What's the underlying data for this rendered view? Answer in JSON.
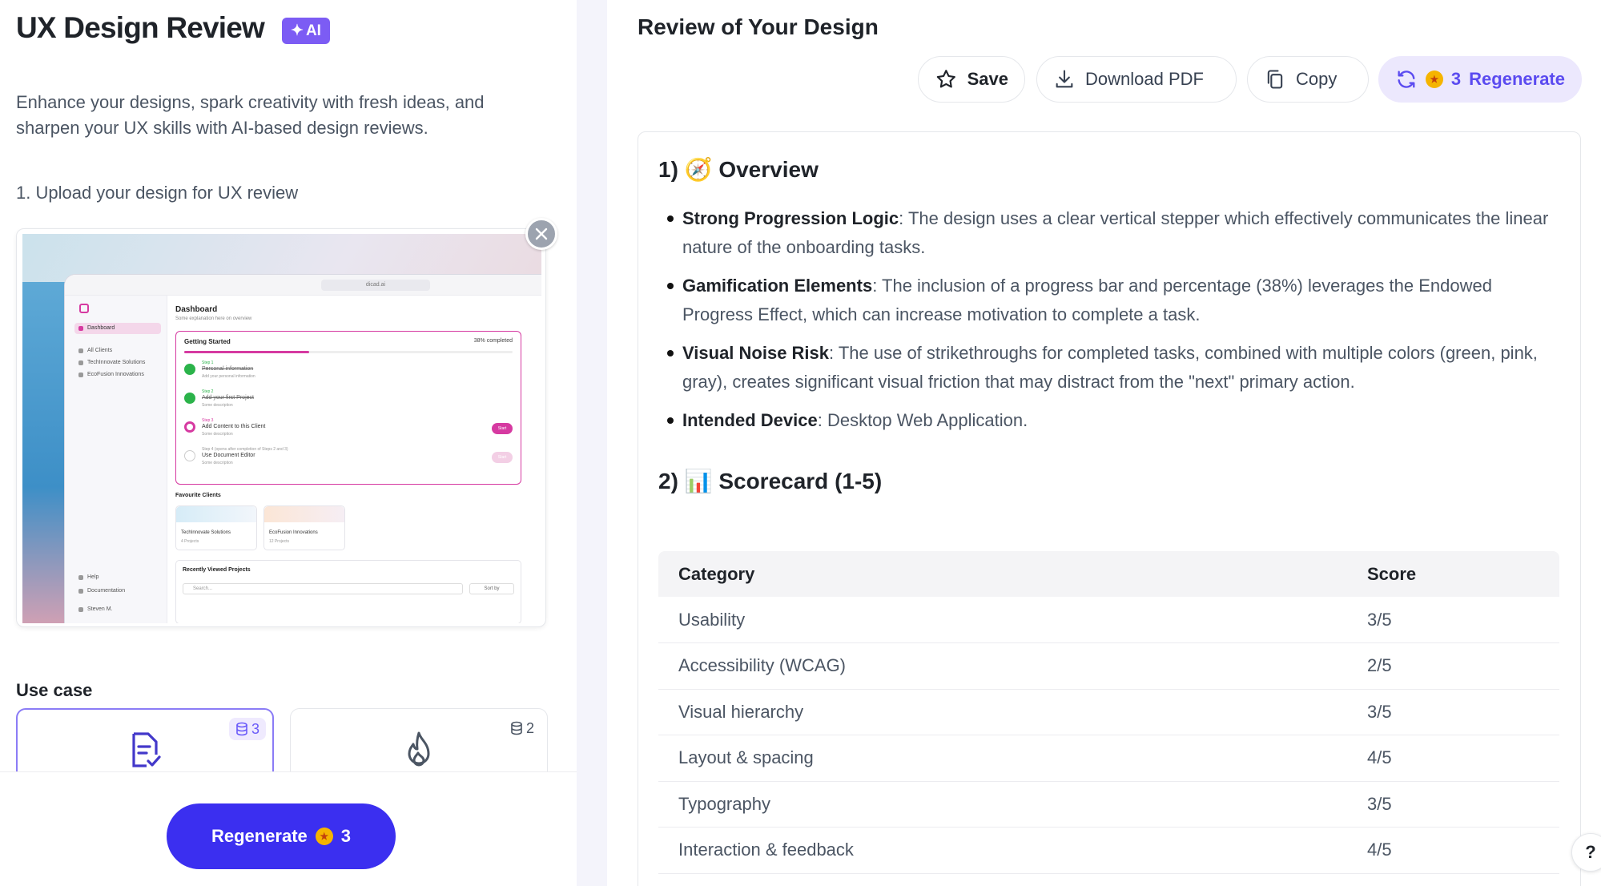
{
  "app": {
    "title": "UX Design Review",
    "badge": "AI",
    "intro": "Enhance your designs, spark creativity with fresh ideas, and sharpen your UX skills with AI-based design reviews.",
    "upload_step": "1. Upload your design for UX review"
  },
  "preview": {
    "url": "dicad.ai",
    "nav": [
      "Dashboard",
      "All Clients",
      "TechInnovate Solutions",
      "EcoFusion Innovations"
    ],
    "nav_bottom": [
      "Help",
      "Documentation",
      "Steven M."
    ],
    "title": "Dashboard",
    "subtitle": "Some explanation here on overview",
    "card_title": "Getting Started",
    "progress_text": "38% completed",
    "progress_value": 0.38,
    "steps": [
      {
        "label": "Step 1",
        "title": "Personal information",
        "desc": "Add your personal information",
        "state": "done"
      },
      {
        "label": "Step 2",
        "title": "Add your first Project",
        "desc": "Some description",
        "state": "done"
      },
      {
        "label": "Step 3",
        "title": "Add Content to this Client",
        "desc": "Some description",
        "state": "current",
        "button": "Start"
      },
      {
        "label": "Step 4 (opens after completion of Steps 2 and 3)",
        "title": "Use Document Editor",
        "desc": "Some description",
        "state": "locked",
        "button": "Start"
      }
    ],
    "fav_title": "Favourite Clients",
    "clients": [
      {
        "name": "TechInnovate Solutions",
        "sub": "4 Projects"
      },
      {
        "name": "EcoFusion Innovations",
        "sub": "12 Projects"
      }
    ],
    "recent_title": "Recently Viewed Projects",
    "search_placeholder": "Search...",
    "sort_label": "Sort by"
  },
  "use_case": {
    "label": "Use case",
    "cards": [
      {
        "icon": "document-check-icon",
        "count": "3",
        "selected": true
      },
      {
        "icon": "flame-icon",
        "count": "2",
        "selected": false
      }
    ]
  },
  "regenerate_button": {
    "label": "Regenerate",
    "count": "3"
  },
  "review": {
    "title": "Review of Your Design",
    "actions": {
      "save": "Save",
      "download": "Download PDF",
      "copy": "Copy",
      "regen_count": "3",
      "regen": "Regenerate"
    },
    "overview_heading": "1) 🧭 Overview",
    "bullets": [
      {
        "term": "Strong Progression Logic",
        "text": ": The design uses a clear vertical stepper which effectively communicates the linear nature of the onboarding tasks."
      },
      {
        "term": "Gamification Elements",
        "text": ": The inclusion of a progress bar and percentage (38%) leverages the Endowed Progress Effect, which can increase motivation to complete a task."
      },
      {
        "term": "Visual Noise Risk",
        "text": ": The use of strikethroughs for completed tasks, combined with multiple colors (green, pink, gray), creates significant visual friction that may distract from the \"next\" primary action."
      },
      {
        "term": "Intended Device",
        "text": ": Desktop Web Application."
      }
    ],
    "scorecard_heading": "2) 📊 Scorecard (1-5)",
    "table": {
      "headers": [
        "Category",
        "Score"
      ],
      "rows": [
        [
          "Usability",
          "3/5"
        ],
        [
          "Accessibility (WCAG)",
          "2/5"
        ],
        [
          "Visual hierarchy",
          "3/5"
        ],
        [
          "Layout & spacing",
          "4/5"
        ],
        [
          "Typography",
          "3/5"
        ],
        [
          "Interaction & feedback",
          "4/5"
        ]
      ]
    }
  },
  "colors": {
    "accent": "#3b2ff0",
    "ai_badge": "#7c5cf4",
    "pink": "#d63aa1",
    "green": "#2bb34a"
  }
}
